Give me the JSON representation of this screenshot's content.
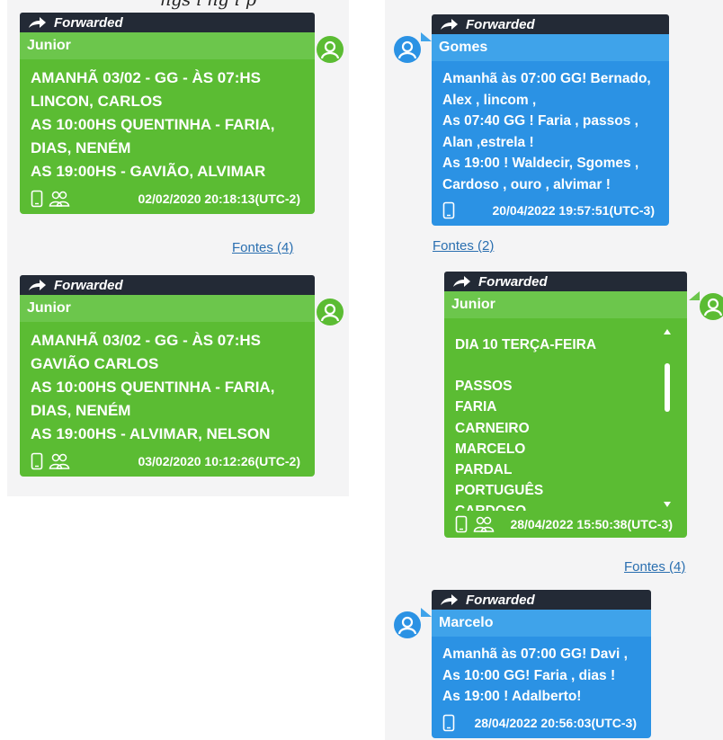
{
  "top_cut_text": "ngs i ng i p",
  "forwarded_label": "Forwarded",
  "messages": [
    {
      "sender": "Junior",
      "lines": [
        "AMANHÃ 03/02 - GG - ÀS 07:HS",
        "LINCON, CARLOS",
        "AS 10:00HS QUENTINHA - FARIA,",
        "DIAS, NENÉM",
        "AS 19:00HS - GAVIÃO, ALVIMAR"
      ],
      "timestamp": "02/02/2020 20:18:13(UTC-2)",
      "fontes": "Fontes (4)"
    },
    {
      "sender": "Junior",
      "lines": [
        "AMANHÃ 03/02 - GG - ÀS 07:HS",
        "GAVIÃO CARLOS",
        "AS 10:00HS QUENTINHA - FARIA,",
        "DIAS, NENÉM",
        "AS 19:00HS - ALVIMAR, NELSON"
      ],
      "timestamp": "03/02/2020 10:12:26(UTC-2)"
    },
    {
      "sender": "Gomes",
      "lines": [
        "Amanhã às 07:00 GG! Bernado,",
        "Alex , lincom ,",
        "As 07:40 GG ! Faria , passos ,",
        "Alan ,estrela !",
        "As 19:00 ! Waldecir, Sgomes ,",
        "Cardoso , ouro , alvimar !"
      ],
      "timestamp": "20/04/2022 19:57:51(UTC-3)",
      "fontes": "Fontes (2)"
    },
    {
      "sender": "Junior",
      "lines": [
        "DIA 10 TERÇA-FEIRA",
        "",
        "PASSOS",
        "FARIA",
        "CARNEIRO",
        "MARCELO",
        "PARDAL",
        "PORTUGUÊS",
        "CARDOSO"
      ],
      "timestamp": "28/04/2022 15:50:38(UTC-3)",
      "fontes": "Fontes (4)"
    },
    {
      "sender": "Marcelo",
      "lines": [
        "Amanhã às 07:00 GG! Davi ,",
        "As 10:00 GG! Faria , dias !",
        "As 19:00 ! Adalberto!"
      ],
      "timestamp": "28/04/2022 20:56:03(UTC-3)"
    }
  ],
  "colors": {
    "green": "#5bbc33",
    "blue": "#2b92e4",
    "dark": "#232a36"
  },
  "icons": [
    "forward-arrow-icon",
    "phone-icon",
    "group-icon",
    "user-avatar-icon"
  ]
}
